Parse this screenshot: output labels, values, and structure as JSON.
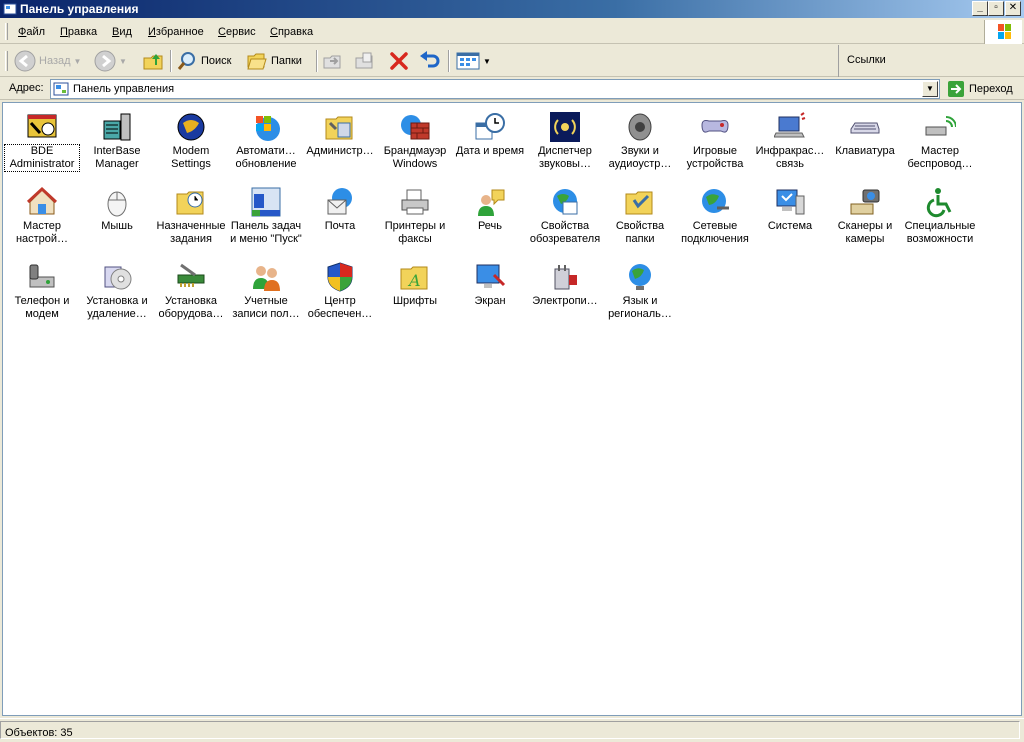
{
  "window": {
    "title": "Панель управления"
  },
  "menu": [
    "Файл",
    "Правка",
    "Вид",
    "Избранное",
    "Сервис",
    "Справка"
  ],
  "toolbar": {
    "back": "Назад",
    "search": "Поиск",
    "folders": "Папки",
    "links": "Ссылки"
  },
  "address": {
    "label": "Адрес:",
    "value": "Панель управления",
    "go": "Переход"
  },
  "items": [
    "BDE\nAdministrator",
    "InterBase\nManager",
    "Modem\nSettings",
    "Автомати…\nобновление",
    "Администр…",
    "Брандмауэр\nWindows",
    "Дата и время",
    "Диспетчер\nзвуковы…",
    "Звуки и\nаудиоустр…",
    "Игровые\nустройства",
    "Инфракрас…\nсвязь",
    "Клавиатура",
    "Мастер\nбеспровод…",
    "Мастер\nнастрой…",
    "Мышь",
    "Назначенные\nзадания",
    "Панель задач\nи меню \"Пуск\"",
    "Почта",
    "Принтеры и\nфаксы",
    "Речь",
    "Свойства\nобозревателя",
    "Свойства\nпапки",
    "Сетевые\nподключения",
    "Система",
    "Сканеры и\nкамеры",
    "Специальные\nвозможности",
    "Телефон и\nмодем",
    "Установка и\nудаление…",
    "Установка\nоборудова…",
    "Учетные\nзаписи пол…",
    "Центр\nобеспечен…",
    "Шрифты",
    "Экран",
    "Электропи…",
    "Язык и\nрегиональ…"
  ],
  "status": "Объектов: 35"
}
